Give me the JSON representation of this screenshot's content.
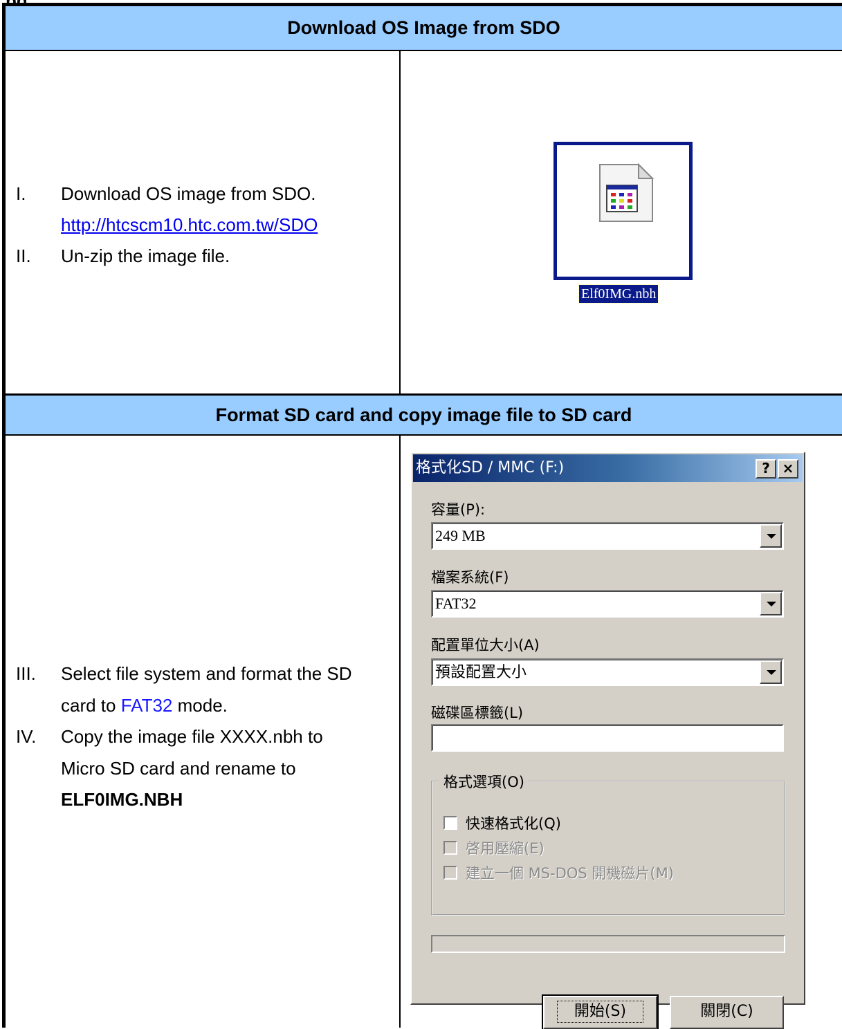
{
  "header_fragment": "pg",
  "section1": {
    "title": "Download OS Image from SDO",
    "steps": [
      {
        "num": "I.",
        "text": "Download OS image from SDO."
      },
      {
        "num": "II.",
        "text": "Un-zip the image file."
      }
    ],
    "link": "http://htcscm10.htc.com.tw/SDO",
    "file_name": "Elf0IMG.nbh"
  },
  "section2": {
    "title": "Format SD card and copy image file to SD card",
    "step3": {
      "num": "III.",
      "line1": "Select file system and format the SD",
      "line2_pre": "card to ",
      "highlight": "FAT32",
      "line2_post": " mode."
    },
    "step4": {
      "num": "IV.",
      "line1": "Copy the image file XXXX.nbh to",
      "line2": "Micro SD card and rename to",
      "line3": "ELF0IMG.NBH"
    }
  },
  "dialog": {
    "title": "格式化SD / MMC (F:)",
    "help_btn": "?",
    "close_btn": "×",
    "capacity_label": "容量(P):",
    "capacity_value": "249 MB",
    "filesystem_label": "檔案系統(F)",
    "filesystem_value": "FAT32",
    "alloc_label": "配置單位大小(A)",
    "alloc_value": "預設配置大小",
    "volume_label": "磁碟區標籤(L)",
    "volume_value": "",
    "options_legend": "格式選項(O)",
    "opt_quick": "快速格式化(Q)",
    "opt_compress": "啓用壓縮(E)",
    "opt_msdos": "建立一個 MS-DOS 開機磁片(M)",
    "start_btn": "開始(S)",
    "close_btn_label": "關閉(C)"
  }
}
